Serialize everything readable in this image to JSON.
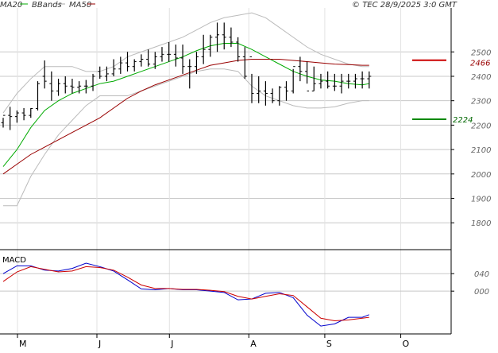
{
  "header": {
    "legend": [
      {
        "label": "MA20",
        "color": "#00aa00"
      },
      {
        "label": "BBands",
        "color": "#aaaaaa"
      },
      {
        "label": "MA50",
        "color": "#990000"
      }
    ],
    "copyright": "© TEC 28/9/2025 3:0 GMT"
  },
  "price_panel": {
    "yticks": [
      "2500",
      "2400",
      "2300",
      "2200",
      "2100",
      "2000",
      "1900",
      "1800"
    ],
    "resistance": {
      "label": "2466",
      "color": "#cc0000"
    },
    "support": {
      "label": "2224",
      "color": "#008800"
    }
  },
  "macd_panel": {
    "title": "MACD",
    "yticks": [
      "040",
      "000"
    ]
  },
  "xaxis": {
    "months": [
      "M",
      "J",
      "J",
      "A",
      "S",
      "O"
    ]
  },
  "chart_data": [
    {
      "type": "line",
      "title": "",
      "ylim": [
        1690,
        2680
      ],
      "xlim": [
        0,
        130
      ],
      "month_ticks": [
        {
          "label": "M",
          "x": 0
        },
        {
          "label": "J",
          "x": 23
        },
        {
          "label": "J",
          "x": 44
        },
        {
          "label": "A",
          "x": 67
        },
        {
          "label": "S",
          "x": 89
        },
        {
          "label": "O",
          "x": 111
        }
      ],
      "ohlc": {
        "x": [
          0,
          2,
          4,
          6,
          8,
          10,
          12,
          14,
          16,
          18,
          20,
          22,
          24,
          26,
          28,
          30,
          32,
          34,
          36,
          38,
          40,
          42,
          44,
          46,
          48,
          50,
          52,
          54,
          56,
          58,
          60,
          62,
          64,
          66,
          68,
          70,
          72,
          74,
          76,
          78,
          80,
          82,
          84,
          86,
          88,
          90,
          92,
          94,
          96,
          98,
          100,
          102,
          104,
          106
        ],
        "open": [
          2210,
          2240,
          2235,
          2250,
          2240,
          2268,
          2400,
          2370,
          2340,
          2370,
          2360,
          2355,
          2360,
          2360,
          2420,
          2400,
          2410,
          2430,
          2455,
          2440,
          2460,
          2470,
          2450,
          2480,
          2490,
          2490,
          2475,
          2440,
          2440,
          2480,
          2510,
          2560,
          2570,
          2560,
          2540,
          2480,
          2480,
          2330,
          2340,
          2330,
          2300,
          2355,
          2340,
          2440,
          2420,
          2340,
          2370,
          2380,
          2360,
          2360,
          2380,
          2380,
          2390,
          2390
        ],
        "high": [
          2230,
          2275,
          2260,
          2270,
          2270,
          2380,
          2465,
          2420,
          2390,
          2400,
          2390,
          2380,
          2385,
          2410,
          2440,
          2440,
          2470,
          2480,
          2500,
          2470,
          2490,
          2510,
          2500,
          2520,
          2540,
          2530,
          2530,
          2470,
          2500,
          2570,
          2570,
          2620,
          2620,
          2600,
          2560,
          2520,
          2410,
          2400,
          2380,
          2350,
          2360,
          2380,
          2430,
          2480,
          2460,
          2440,
          2410,
          2420,
          2410,
          2410,
          2410,
          2410,
          2420,
          2420
        ],
        "low": [
          2190,
          2180,
          2210,
          2220,
          2230,
          2260,
          2350,
          2300,
          2320,
          2330,
          2330,
          2330,
          2330,
          2340,
          2390,
          2380,
          2400,
          2410,
          2420,
          2420,
          2440,
          2440,
          2430,
          2460,
          2460,
          2440,
          2410,
          2350,
          2410,
          2450,
          2480,
          2500,
          2510,
          2520,
          2460,
          2390,
          2290,
          2290,
          2280,
          2290,
          2280,
          2300,
          2330,
          2380,
          2370,
          2340,
          2350,
          2350,
          2340,
          2330,
          2350,
          2350,
          2350,
          2350
        ],
        "close": [
          2240,
          2235,
          2250,
          2240,
          2268,
          2370,
          2380,
          2340,
          2370,
          2360,
          2355,
          2360,
          2360,
          2400,
          2400,
          2410,
          2430,
          2455,
          2440,
          2460,
          2470,
          2450,
          2480,
          2490,
          2490,
          2475,
          2440,
          2440,
          2480,
          2510,
          2560,
          2570,
          2560,
          2540,
          2480,
          2400,
          2330,
          2340,
          2330,
          2300,
          2355,
          2340,
          2440,
          2420,
          2340,
          2370,
          2380,
          2360,
          2360,
          2380,
          2380,
          2390,
          2390,
          2400
        ]
      },
      "series": [
        {
          "name": "MA20",
          "color": "#00aa00",
          "x": [
            0,
            4,
            8,
            12,
            16,
            20,
            24,
            28,
            32,
            36,
            40,
            44,
            48,
            52,
            56,
            60,
            64,
            68,
            72,
            76,
            80,
            84,
            88,
            92,
            96,
            100,
            104,
            106
          ],
          "y": [
            2030,
            2100,
            2190,
            2260,
            2300,
            2330,
            2350,
            2370,
            2380,
            2400,
            2420,
            2440,
            2460,
            2480,
            2505,
            2525,
            2535,
            2535,
            2510,
            2480,
            2450,
            2420,
            2400,
            2385,
            2380,
            2370,
            2365,
            2370
          ]
        },
        {
          "name": "MA50",
          "color": "#990000",
          "x": [
            0,
            4,
            8,
            12,
            16,
            20,
            24,
            28,
            32,
            36,
            40,
            44,
            48,
            52,
            56,
            60,
            64,
            68,
            72,
            76,
            80,
            84,
            88,
            92,
            96,
            100,
            104,
            106
          ],
          "y": [
            2000,
            2040,
            2080,
            2110,
            2140,
            2170,
            2200,
            2230,
            2270,
            2310,
            2340,
            2365,
            2385,
            2405,
            2425,
            2445,
            2455,
            2465,
            2470,
            2470,
            2470,
            2465,
            2460,
            2455,
            2450,
            2448,
            2445,
            2445
          ]
        },
        {
          "name": "BBands upper",
          "color": "#bbbbbb",
          "x": [
            0,
            4,
            8,
            12,
            16,
            20,
            24,
            28,
            32,
            36,
            40,
            44,
            48,
            52,
            56,
            60,
            64,
            68,
            72,
            76,
            80,
            84,
            88,
            92,
            96,
            100,
            104,
            106
          ],
          "y": [
            2250,
            2330,
            2390,
            2440,
            2440,
            2440,
            2420,
            2420,
            2440,
            2480,
            2500,
            2520,
            2540,
            2560,
            2590,
            2620,
            2640,
            2650,
            2660,
            2640,
            2600,
            2560,
            2520,
            2490,
            2470,
            2450,
            2440,
            2440
          ]
        },
        {
          "name": "BBands lower",
          "color": "#bbbbbb",
          "x": [
            0,
            4,
            8,
            12,
            16,
            20,
            24,
            28,
            32,
            36,
            40,
            44,
            48,
            52,
            56,
            60,
            64,
            68,
            72,
            76,
            80,
            84,
            88,
            92,
            96,
            100,
            104,
            106
          ],
          "y": [
            1870,
            1870,
            1990,
            2080,
            2160,
            2220,
            2280,
            2320,
            2320,
            2320,
            2340,
            2360,
            2380,
            2400,
            2420,
            2430,
            2430,
            2420,
            2360,
            2320,
            2300,
            2280,
            2270,
            2270,
            2275,
            2290,
            2300,
            2300
          ]
        }
      ],
      "levels": [
        {
          "label": "2466",
          "value": 2466
        },
        {
          "label": "2224",
          "value": 2224
        }
      ]
    },
    {
      "type": "line",
      "title": "MACD",
      "ylim": [
        -98,
        95
      ],
      "xlim": [
        0,
        130
      ],
      "series": [
        {
          "name": "MACD",
          "color": "#0000cc",
          "x": [
            0,
            4,
            8,
            12,
            16,
            20,
            24,
            28,
            32,
            36,
            40,
            44,
            48,
            52,
            56,
            60,
            64,
            68,
            72,
            76,
            80,
            84,
            88,
            92,
            96,
            100,
            104,
            106
          ],
          "y": [
            40,
            58,
            58,
            48,
            46,
            52,
            64,
            56,
            46,
            26,
            5,
            3,
            6,
            3,
            3,
            0,
            -3,
            -20,
            -18,
            -5,
            -3,
            -15,
            -55,
            -80,
            -75,
            -60,
            -60,
            -54
          ]
        },
        {
          "name": "Signal",
          "color": "#cc0000",
          "x": [
            0,
            4,
            8,
            12,
            16,
            20,
            24,
            28,
            32,
            36,
            40,
            44,
            48,
            52,
            56,
            60,
            64,
            68,
            72,
            76,
            80,
            84,
            88,
            92,
            96,
            100,
            104,
            106
          ],
          "y": [
            22,
            44,
            56,
            50,
            44,
            46,
            56,
            54,
            48,
            32,
            14,
            6,
            6,
            4,
            4,
            2,
            -1,
            -12,
            -18,
            -12,
            -6,
            -10,
            -36,
            -62,
            -68,
            -66,
            -62,
            -60
          ]
        }
      ]
    }
  ]
}
